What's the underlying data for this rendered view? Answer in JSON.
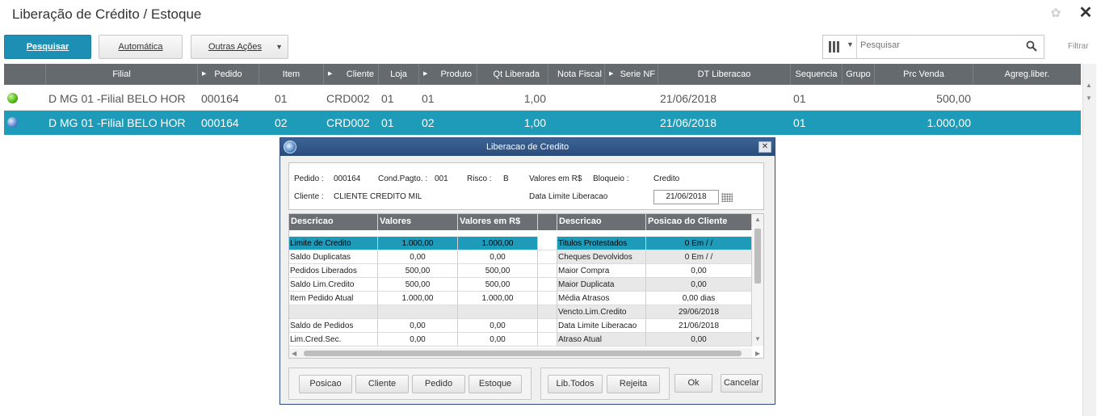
{
  "header": {
    "title": "Liberação de Crédito / Estoque",
    "settings_icon": "gear-icon",
    "close_glyph": "✕"
  },
  "toolbar": {
    "pesquisar": "Pesquisar",
    "automatica": "Automática",
    "outras_acoes": "Outras Ações",
    "search_placeholder": "Pesquisar",
    "filtrar": "Filtrar"
  },
  "grid": {
    "columns": [
      "Filial",
      "Pedido",
      "Item",
      "Cliente",
      "Loja",
      "Produto",
      "Qt Liberada",
      "Nota Fiscal",
      "Serie NF",
      "DT Liberacao",
      "Sequencia",
      "Grupo",
      "Prc Venda",
      "Agreg.liber."
    ],
    "rows": [
      {
        "status": "green",
        "filial": "D MG 01 -Filial BELO HOR",
        "pedido": "000164",
        "item": "01",
        "cliente": "CRD002",
        "loja": "01",
        "produto": "01",
        "qt_liberada": "1,00",
        "nota_fiscal": "",
        "serie_nf": "",
        "dt_liberacao": "21/06/2018",
        "sequencia": "01",
        "grupo": "",
        "prc_venda": "500,00",
        "agreg": ""
      },
      {
        "status": "blue",
        "filial": "D MG 01 -Filial BELO HOR",
        "pedido": "000164",
        "item": "02",
        "cliente": "CRD002",
        "loja": "01",
        "produto": "02",
        "qt_liberada": "1,00",
        "nota_fiscal": "",
        "serie_nf": "",
        "dt_liberacao": "21/06/2018",
        "sequencia": "01",
        "grupo": "",
        "prc_venda": "1.000,00",
        "agreg": ""
      }
    ]
  },
  "dialog": {
    "title": "Liberacao de Credito",
    "info": {
      "pedido_label": "Pedido :",
      "pedido": "000164",
      "cond_label": "Cond.Pagto. :",
      "cond": "001",
      "risco_label": "Risco :",
      "risco": "B",
      "valores_label": "Valores em R$",
      "bloqueio_label": "Bloqueio :",
      "bloqueio": "Credito",
      "cliente_label": "Cliente :",
      "cliente": "CLIENTE CREDITO MIL",
      "data_limite_label": "Data Limite Liberacao",
      "data_limite": "21/06/2018"
    },
    "table": {
      "headers": [
        "Descricao",
        "Valores",
        "Valores em R$",
        "",
        "Descricao",
        "Posicao do Cliente"
      ],
      "rows": [
        [
          "Limite de Credito",
          "1.000,00",
          "1.000,00",
          "",
          "Titulos Protestados",
          "0     Em      /  /"
        ],
        [
          "Saldo Duplicatas",
          "0,00",
          "0,00",
          "",
          "Cheques Devolvidos",
          "0     Em      /  /"
        ],
        [
          "Pedidos Liberados",
          "500,00",
          "500,00",
          "",
          "Maior Compra",
          "0,00"
        ],
        [
          "Saldo Lim.Credito",
          "500,00",
          "500,00",
          "",
          "Maior Duplicata",
          "0,00"
        ],
        [
          "Item Pedido Atual",
          "1.000,00",
          "1.000,00",
          "",
          "Média Atrasos",
          "0,00     dias"
        ],
        [
          "",
          "",
          "",
          "",
          "Vencto.Lim.Credito",
          "29/06/2018"
        ],
        [
          "Saldo de Pedidos",
          "0,00",
          "0,00",
          "",
          "Data Limite Liberacao",
          "21/06/2018"
        ],
        [
          "Lim.Cred.Sec.",
          "0,00",
          "0,00",
          "",
          "Atraso Atual",
          "0,00"
        ]
      ]
    },
    "buttons": {
      "posicao": "Posicao",
      "cliente": "Cliente",
      "pedido": "Pedido",
      "estoque": "Estoque",
      "lib_todos": "Lib.Todos",
      "rejeita": "Rejeita",
      "ok": "Ok",
      "cancelar": "Cancelar"
    }
  }
}
